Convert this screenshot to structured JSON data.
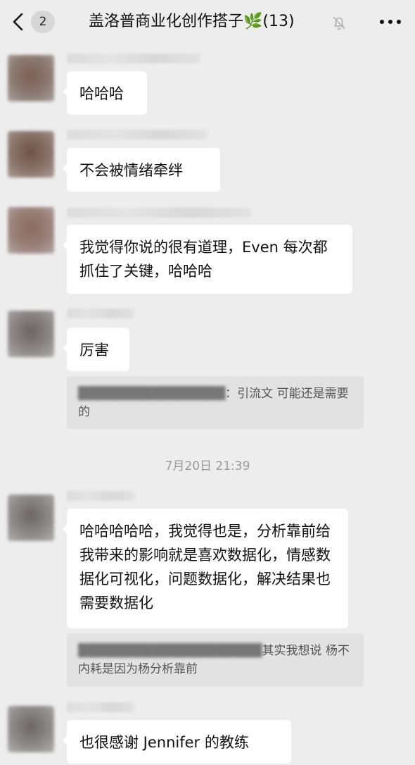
{
  "nav": {
    "unread_count": "2",
    "title": "盖洛普商业化创作搭子🌿(13)"
  },
  "messages": [
    {
      "text": "哈哈哈"
    },
    {
      "text": "不会被情绪牵绊"
    },
    {
      "text": "我觉得你说的很有道理，Even 每次都抓住了关键，哈哈哈"
    },
    {
      "text": "厉害"
    },
    {
      "text": "哈哈哈哈哈，我觉得也是，分析靠前给我带来的影响就是喜欢数据化，情感数据化可视化，问题数据化，解决结果也需要数据化"
    },
    {
      "text": "也很感谢 Jennifer 的教练"
    }
  ],
  "quotes": [
    {
      "visible_text": "：引流文 可能还是需要的"
    },
    {
      "visible_text": "其实我想说 杨不内耗是因为杨分析靠前"
    }
  ],
  "timestamp": "7月20日 21:39",
  "icons": {
    "back": "chevron-left-icon",
    "mute": "bell-off-icon",
    "more": "more-dots-icon"
  },
  "colors": {
    "background": "#ededed",
    "bubble": "#ffffff",
    "quote": "#e2e2e2"
  }
}
